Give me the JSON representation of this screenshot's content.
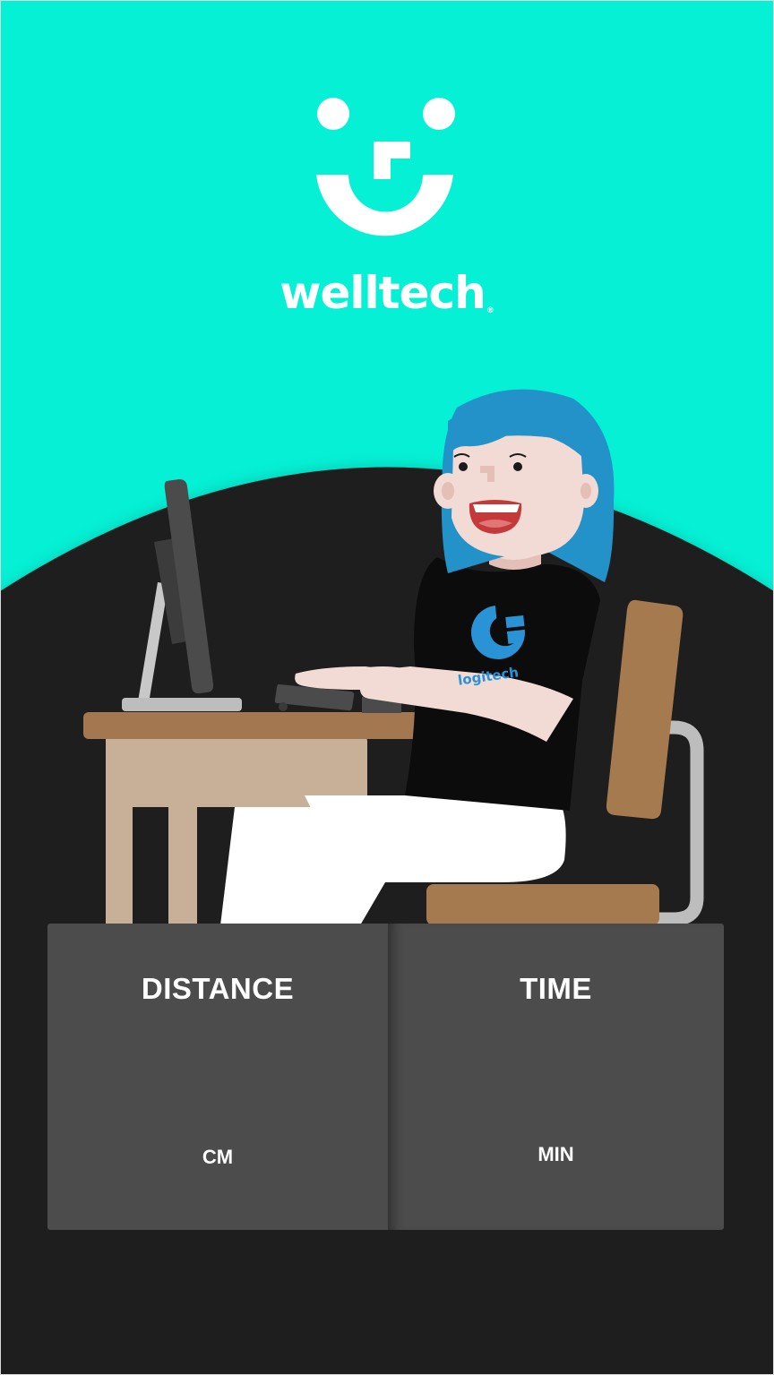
{
  "brand": {
    "name": "welltech",
    "trademark": "®"
  },
  "shirt_logo": {
    "text": "logitech"
  },
  "stats": {
    "distance": {
      "label": "DISTANCE",
      "value": "",
      "unit": "CM"
    },
    "time": {
      "label": "TIME",
      "value": "",
      "unit": "MIN"
    }
  },
  "colors": {
    "brand_accent": "#06f0d5",
    "background_dark": "#1e1e1e",
    "panel": "#4c4c4c",
    "hair": "#2392c9",
    "desk_top": "#a3774f",
    "desk_body": "#c7b097",
    "chair": "#a57a4f",
    "logitech_blue": "#2a93d5"
  },
  "icons": {
    "logo": "smiley-face-logo-icon"
  }
}
